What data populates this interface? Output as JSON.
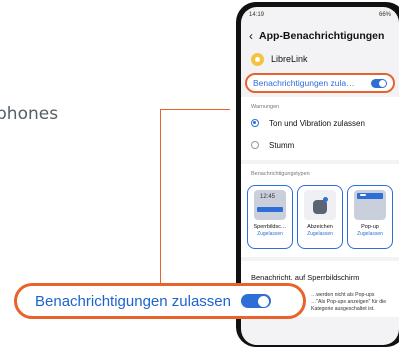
{
  "background": {
    "partial_text": "phones"
  },
  "status_bar": {
    "time": "14:19",
    "battery": "66%"
  },
  "app_bar": {
    "title": "App-Benachrichtigungen"
  },
  "app": {
    "name": "LibreLink"
  },
  "master_toggle": {
    "label": "Benachrichtigungen zula…",
    "on": true
  },
  "warnings": {
    "label": "Warnungen",
    "options": [
      {
        "label": "Ton und Vibration zulassen",
        "selected": true
      },
      {
        "label": "Stumm",
        "selected": false
      }
    ]
  },
  "notification_types": {
    "label": "Benachrichtigungstypen",
    "items": [
      {
        "title": "Sperrbildsc…",
        "status": "Zugelassen",
        "thumb_time": "12:45"
      },
      {
        "title": "Abzeichen",
        "status": "Zugelassen"
      },
      {
        "title": "Pop-up",
        "status": "Zugelassen"
      }
    ]
  },
  "lock_screen_row": {
    "label": "Benachricht. auf Sperrbildschirm"
  },
  "footer_note": "…werden nicht als Pop-ups …\"Als Pop-ups anzeigen\" für die Kategorie ausgeschaltet ist.",
  "callout": {
    "label": "Benachrichtigungen zulassen",
    "on": true
  },
  "colors": {
    "accent": "#e8622c",
    "brand_blue": "#2d6fd6"
  }
}
